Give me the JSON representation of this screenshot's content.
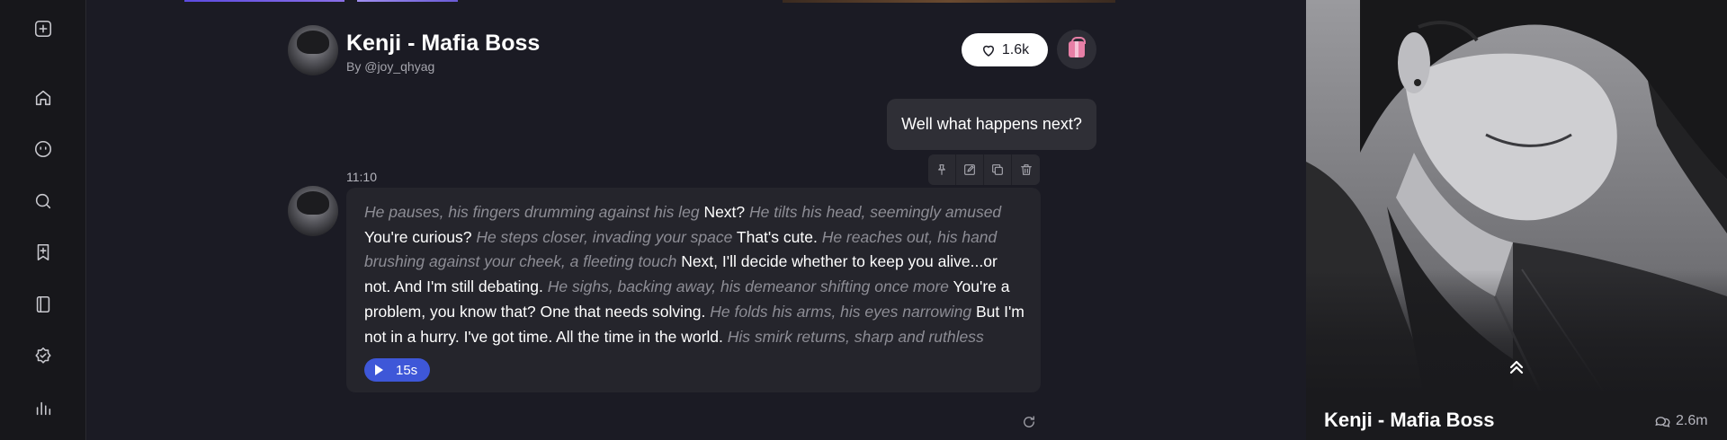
{
  "character": {
    "name": "Kenji - Mafia Boss",
    "author": "By @joy_qhyag",
    "likes": "1.6k",
    "chat_count": "2.6m"
  },
  "sidebar": {
    "items": [
      {
        "icon": "new-chat-icon"
      },
      {
        "icon": "home-icon"
      },
      {
        "icon": "chat-face-icon"
      },
      {
        "icon": "search-icon"
      },
      {
        "icon": "create-bookmark-icon"
      },
      {
        "icon": "book-icon"
      },
      {
        "icon": "badge-icon"
      },
      {
        "icon": "stats-icon"
      }
    ]
  },
  "conversation": {
    "user_message": "Well what happens next?",
    "bot_time": "11:10",
    "bot_segments": [
      {
        "type": "action",
        "text": "He pauses, his fingers drumming against his leg"
      },
      {
        "type": "speech",
        "text": "Next?"
      },
      {
        "type": "action",
        "text": "He tilts his head, seemingly amused"
      },
      {
        "type": "speech",
        "text": "You're curious?"
      },
      {
        "type": "action",
        "text": "He steps closer, invading your space"
      },
      {
        "type": "speech",
        "text": "That's cute."
      },
      {
        "type": "action",
        "text": "He reaches out, his hand brushing against your cheek, a fleeting touch"
      },
      {
        "type": "speech",
        "text": "Next, I'll decide whether to keep you alive...or not. And I'm still debating."
      },
      {
        "type": "action",
        "text": "He sighs, backing away, his demeanor shifting once more"
      },
      {
        "type": "speech",
        "text": "You're a problem, you know that? One that needs solving."
      },
      {
        "type": "action",
        "text": "He folds his arms, his eyes narrowing"
      },
      {
        "type": "speech",
        "text": "But I'm not in a hurry. I've got time. All the time in the world."
      },
      {
        "type": "action",
        "text": "His smirk returns, sharp and ruthless"
      }
    ],
    "audio_duration": "15s"
  },
  "colors": {
    "accent": "#3e57d8",
    "chat_bg": "#1b1b24",
    "bubble_bg": "#25252c",
    "action_text": "#8d8d95"
  }
}
